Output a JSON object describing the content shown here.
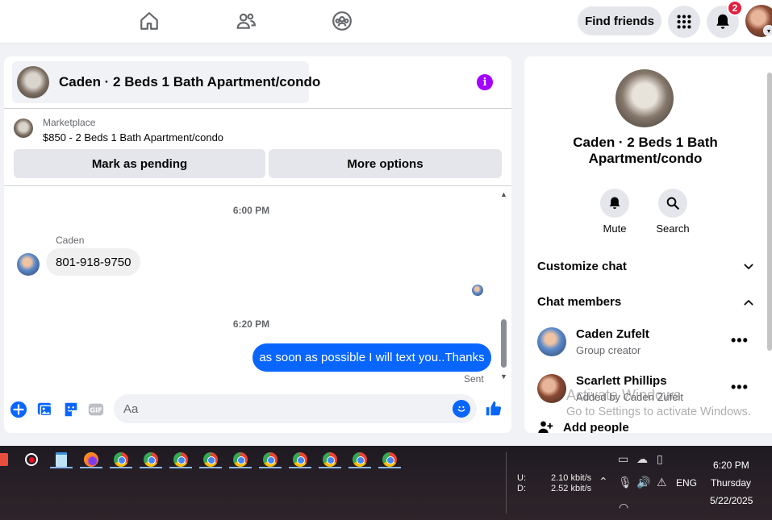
{
  "topnav": {
    "find_friends": "Find friends",
    "notification_count": "2"
  },
  "chat": {
    "title": "Caden · 2 Beds 1 Bath Apartment/condo",
    "marketplace_label": "Marketplace",
    "listing": "$850 - 2 Beds 1 Bath Apartment/condo",
    "mark_pending": "Mark as pending",
    "more_options": "More options",
    "time1": "6:00 PM",
    "sender": "Caden",
    "msg_in": "801-918-9750",
    "time2": "6:20 PM",
    "msg_out": "as soon as possible I will text you..Thanks",
    "sent": "Sent",
    "composer_placeholder": "Aa"
  },
  "info_panel": {
    "title": "Caden · 2 Beds 1 Bath Apartment/condo",
    "mute": "Mute",
    "search": "Search",
    "customize_chat": "Customize chat",
    "chat_members": "Chat members",
    "members": [
      {
        "name": "Caden Zufelt",
        "role": "Group creator"
      },
      {
        "name": "Scarlett Phillips",
        "role": "Added by Caden Zufelt"
      }
    ],
    "add_people": "Add people"
  },
  "watermark": {
    "line1": "Activate Windows",
    "line2": "Go to Settings to activate Windows."
  },
  "taskbar": {
    "upload_label": "U:",
    "download_label": "D:",
    "upload_speed": "2.10 kbit/s",
    "download_speed": "2.52 kbit/s",
    "language": "ENG",
    "time": "6:20 PM",
    "day": "Thursday",
    "date": "5/22/2025"
  }
}
